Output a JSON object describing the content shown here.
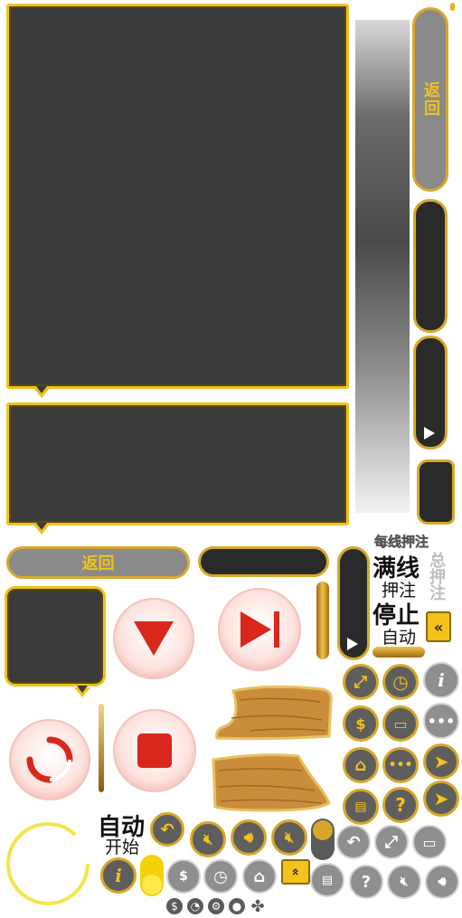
{
  "buttons": {
    "back_vertical": "返回",
    "back_horizontal": "返回"
  },
  "labels": {
    "bet_per_line": "每线押注",
    "max_lines": "满线",
    "bet": "押注",
    "total_bet": "总押注",
    "stop": "停止",
    "auto": "自动",
    "auto_start_line1": "自动",
    "auto_start_line2": "开始"
  },
  "colors": {
    "gold": "#f0c21a",
    "panel_dark": "#3a3a3a",
    "button_gray": "#5e5e5e",
    "red": "#d9271c",
    "wood": "#c98d3c"
  }
}
